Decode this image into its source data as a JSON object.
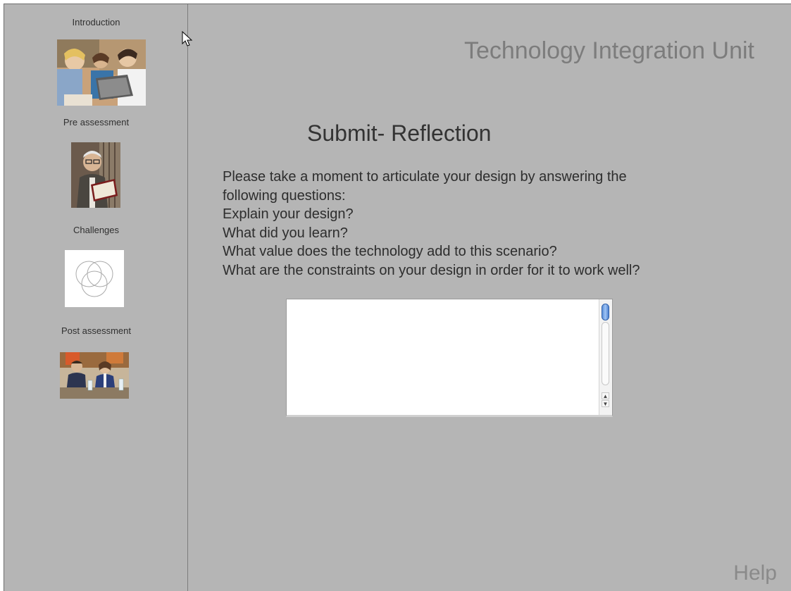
{
  "app": {
    "title": "Technology Integration Unit",
    "help_label": "Help"
  },
  "sidebar": {
    "items": [
      {
        "label": "Introduction"
      },
      {
        "label": "Pre assessment"
      },
      {
        "label": "Challenges"
      },
      {
        "label": "Post assessment"
      }
    ]
  },
  "main": {
    "heading": "Submit- Reflection",
    "prompt_lines": [
      "Please take a moment to articulate your design by answering the",
      "following questions:",
      "Explain your design?",
      "What did you learn?",
      "What value does the technology add to this scenario?",
      "What are the constraints on your design in order for it to work well?"
    ],
    "answer_value": ""
  },
  "colors": {
    "background": "#b5b5b5",
    "title": "#7c7c7c",
    "scroll_thumb": "#5b8fd8"
  }
}
